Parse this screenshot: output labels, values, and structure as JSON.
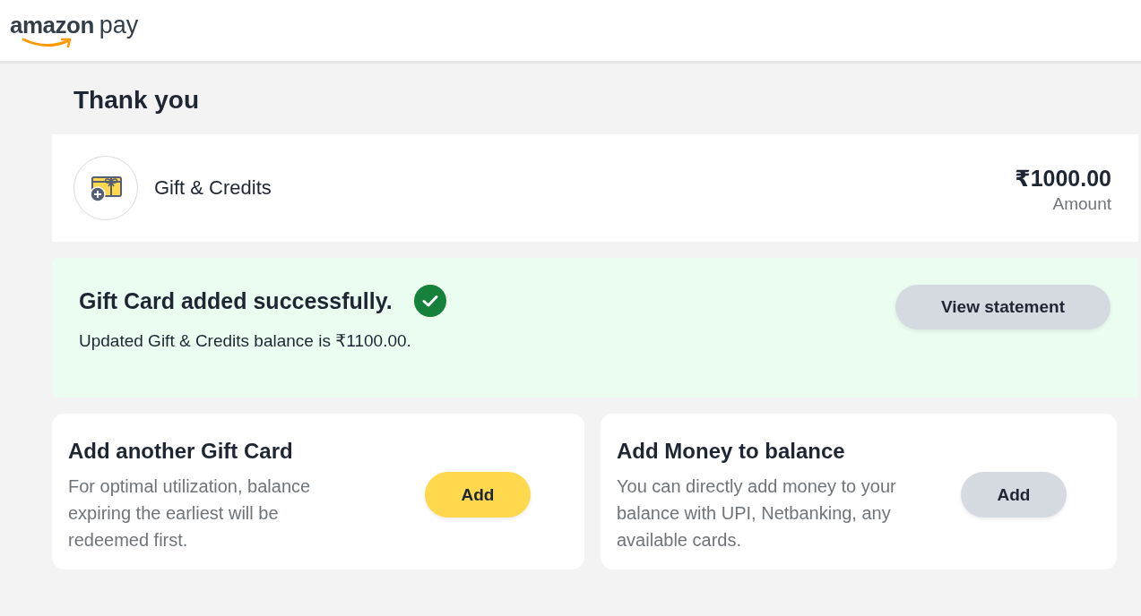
{
  "header": {
    "logo": {
      "brand": "amazon",
      "product": "pay"
    }
  },
  "title": "Thank you",
  "payment": {
    "method": "Gift & Credits",
    "amount": "₹1000.00",
    "amount_label": "Amount"
  },
  "success_banner": {
    "title": "Gift Card added successfully.",
    "message": "Updated Gift & Credits balance is ₹1100.00.",
    "button": "View statement"
  },
  "cards": [
    {
      "title": "Add another Gift Card",
      "description": "For optimal utilization, balance expiring the earliest will be redeemed first.",
      "button": {
        "label": "Add",
        "kind": "primary"
      }
    },
    {
      "title": "Add Money to balance",
      "description": "You can directly add money to your balance with UPI, Netbanking, any available cards.",
      "button": {
        "label": "Add",
        "kind": "secondary"
      }
    }
  ]
}
